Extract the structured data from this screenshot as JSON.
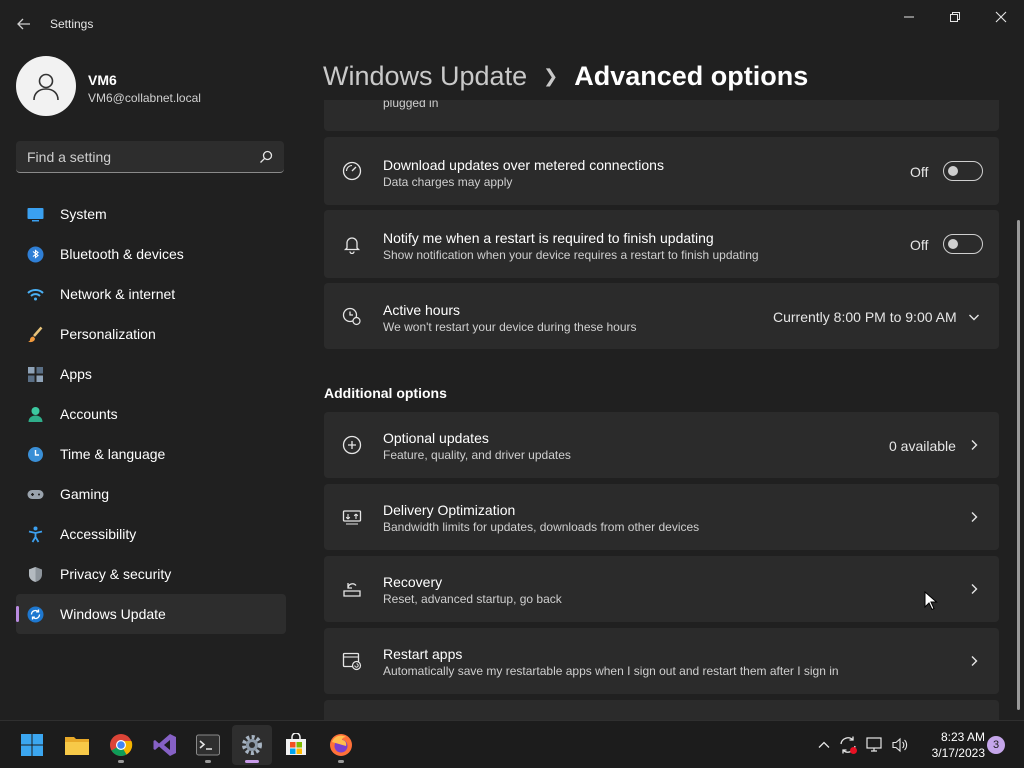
{
  "window": {
    "title": "Settings"
  },
  "profile": {
    "name": "VM6",
    "email": "VM6@collabnet.local"
  },
  "search": {
    "placeholder": "Find a setting"
  },
  "nav": {
    "items": [
      {
        "label": "System",
        "icon": "system-icon"
      },
      {
        "label": "Bluetooth & devices",
        "icon": "bluetooth-icon"
      },
      {
        "label": "Network & internet",
        "icon": "network-icon"
      },
      {
        "label": "Personalization",
        "icon": "brush-icon"
      },
      {
        "label": "Apps",
        "icon": "apps-icon"
      },
      {
        "label": "Accounts",
        "icon": "accounts-icon"
      },
      {
        "label": "Time & language",
        "icon": "clock-globe-icon"
      },
      {
        "label": "Gaming",
        "icon": "gamepad-icon"
      },
      {
        "label": "Accessibility",
        "icon": "accessibility-icon"
      },
      {
        "label": "Privacy & security",
        "icon": "shield-icon"
      },
      {
        "label": "Windows Update",
        "icon": "update-icon"
      }
    ],
    "active": "Windows Update"
  },
  "breadcrumb": {
    "parent": "Windows Update",
    "current": "Advanced options"
  },
  "cards": {
    "partial": {
      "subtitle": "plugged in"
    },
    "metered": {
      "title": "Download updates over metered connections",
      "subtitle": "Data charges may apply",
      "state": "Off"
    },
    "notify": {
      "title": "Notify me when a restart is required to finish updating",
      "subtitle": "Show notification when your device requires a restart to finish updating",
      "state": "Off"
    },
    "active_hours": {
      "title": "Active hours",
      "subtitle": "We won't restart your device during these hours",
      "value": "Currently 8:00 PM to 9:00 AM"
    }
  },
  "additional": {
    "heading": "Additional options",
    "optional": {
      "title": "Optional updates",
      "subtitle": "Feature, quality, and driver updates",
      "value": "0 available"
    },
    "delivery": {
      "title": "Delivery Optimization",
      "subtitle": "Bandwidth limits for updates, downloads from other devices"
    },
    "recovery": {
      "title": "Recovery",
      "subtitle": "Reset, advanced startup, go back"
    },
    "restart_apps": {
      "title": "Restart apps",
      "subtitle": "Automatically save my restartable apps when I sign out and restart them after I sign in"
    }
  },
  "taskbar": {
    "apps": [
      "start-icon",
      "file-explorer-icon",
      "chrome-icon",
      "visual-studio-icon",
      "terminal-icon",
      "settings-icon",
      "store-icon",
      "firefox-icon"
    ],
    "time": "8:23 AM",
    "date": "3/17/2023",
    "notifications": "3"
  },
  "colors": {
    "accent": "#b98be0",
    "background": "#202020",
    "card": "#2b2b2b"
  }
}
